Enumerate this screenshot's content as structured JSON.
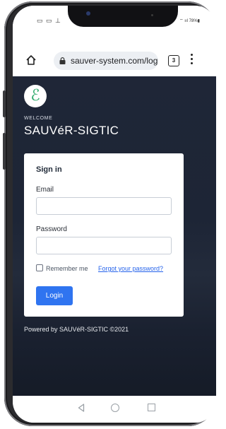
{
  "status_bar": {
    "left_icons": "▭ ▭ ⊥",
    "right_text": "⌔ ııl 78%▮"
  },
  "browser": {
    "url": "sauver-system.com/logi",
    "tab_count": "3",
    "icons": [
      "home-icon",
      "lock-icon",
      "tabs-icon",
      "more-vert-icon"
    ]
  },
  "app": {
    "logo_glyph": "ℰ",
    "welcome": "WELCOME",
    "title": "SAUVéR-SIGTIC"
  },
  "signin": {
    "title": "Sign in",
    "email_label": "Email",
    "email_value": "",
    "password_label": "Password",
    "password_value": "",
    "remember_label": "Remember me",
    "remember_checked": false,
    "forgot_label": "Forgot your password?",
    "login_label": "Login"
  },
  "footer": {
    "powered": "Powered by SAUVéR-SIGTIC ©2021"
  },
  "nav": {
    "icons": [
      "back-icon",
      "home-circle-icon",
      "recents-icon"
    ]
  },
  "colors": {
    "accent": "#2f74f0",
    "page_bg": "#1f2637",
    "logo": "#2eaa6c",
    "link": "#2563eb"
  }
}
